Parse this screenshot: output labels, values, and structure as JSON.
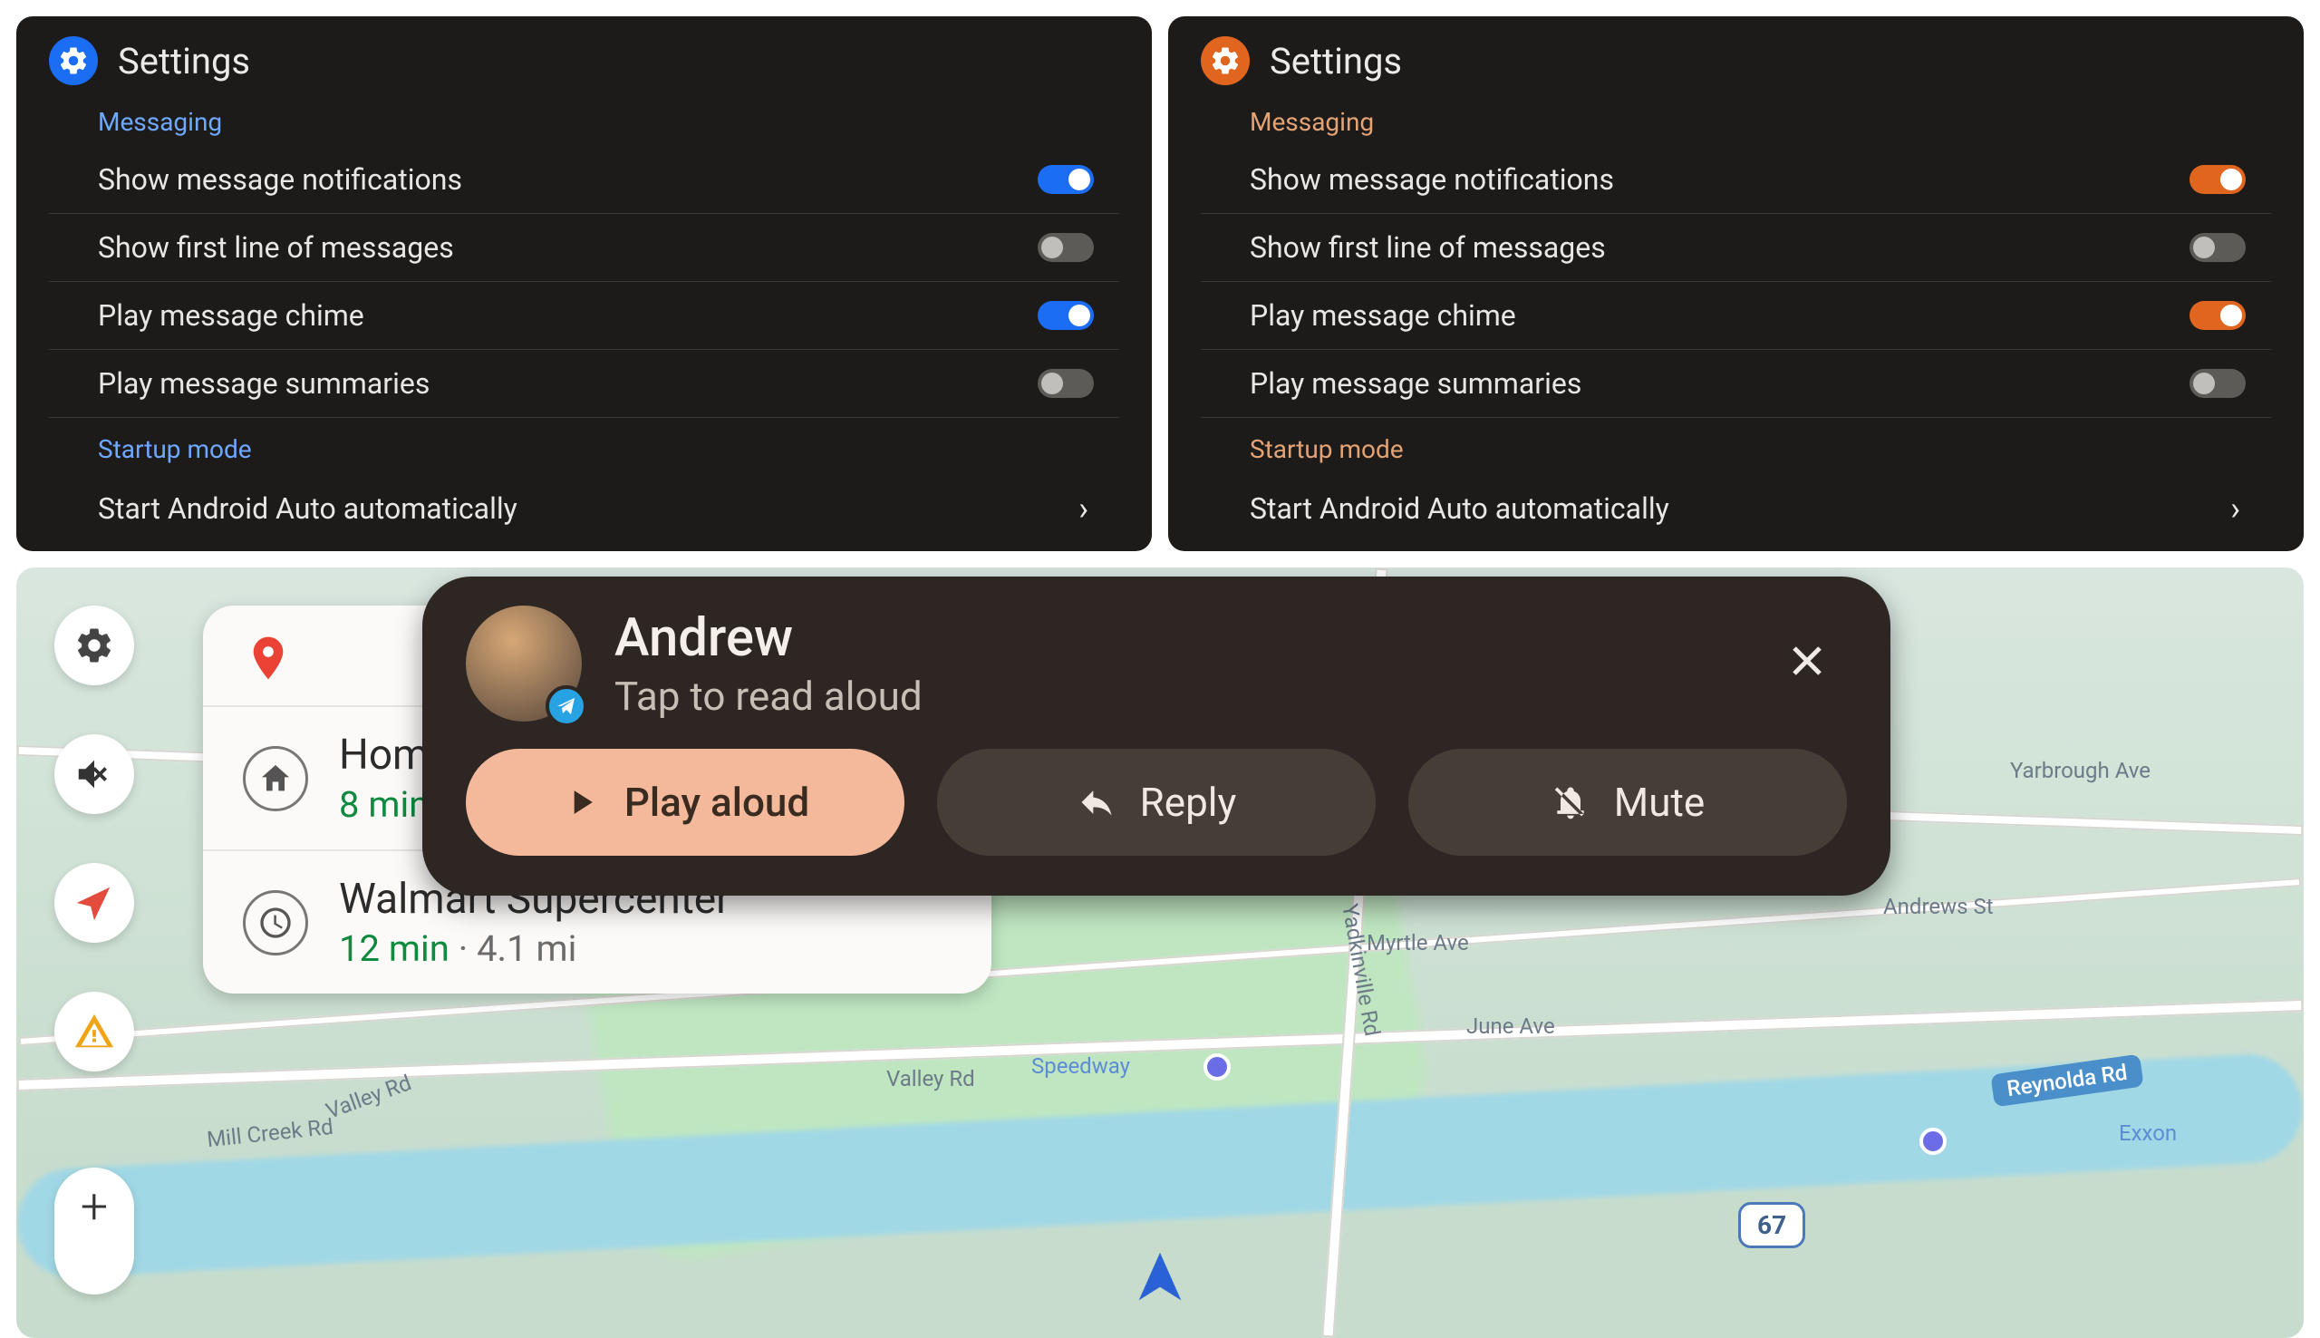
{
  "panels": [
    {
      "title": "Settings",
      "accent": "blue",
      "sections": [
        {
          "label": "Messaging",
          "items": [
            {
              "label": "Show message notifications",
              "toggle": "on"
            },
            {
              "label": "Show first line of messages",
              "toggle": "off"
            },
            {
              "label": "Play message chime",
              "toggle": "on"
            },
            {
              "label": "Play message summaries",
              "toggle": "off"
            }
          ]
        },
        {
          "label": "Startup mode",
          "items": [
            {
              "label": "Start Android Auto automatically",
              "chevron": true
            }
          ]
        }
      ]
    },
    {
      "title": "Settings",
      "accent": "orange",
      "sections": [
        {
          "label": "Messaging",
          "items": [
            {
              "label": "Show message notifications",
              "toggle": "on"
            },
            {
              "label": "Show first line of messages",
              "toggle": "off"
            },
            {
              "label": "Play message chime",
              "toggle": "on"
            },
            {
              "label": "Play message summaries",
              "toggle": "off"
            }
          ]
        },
        {
          "label": "Startup mode",
          "items": [
            {
              "label": "Start Android Auto automatically",
              "chevron": true
            }
          ]
        }
      ]
    }
  ],
  "map": {
    "road_labels": {
      "valley": "Valley Rd",
      "valley2": "Valley Rd",
      "myrtle": "Myrtle Ave",
      "june": "June Ave",
      "andrews": "Andrews St",
      "yarbrough": "Yarbrough Ave",
      "millcreek": "Mill Creek Rd",
      "yadkinville": "Yadkinville Rd",
      "reynolda": "Reynolda Rd",
      "speedway": "Speedway",
      "exxon": "Exxon",
      "shield": "67"
    },
    "destinations": [
      {
        "title": "Home",
        "sub_time": "8 min",
        "sub": ""
      },
      {
        "title": "Walmart Supercenter",
        "sub_time": "12 min",
        "sub": " · 4.1 mi"
      }
    ]
  },
  "notification": {
    "name": "Andrew",
    "subtitle": "Tap to read aloud",
    "actions": {
      "play": "Play aloud",
      "reply": "Reply",
      "mute": "Mute"
    }
  }
}
